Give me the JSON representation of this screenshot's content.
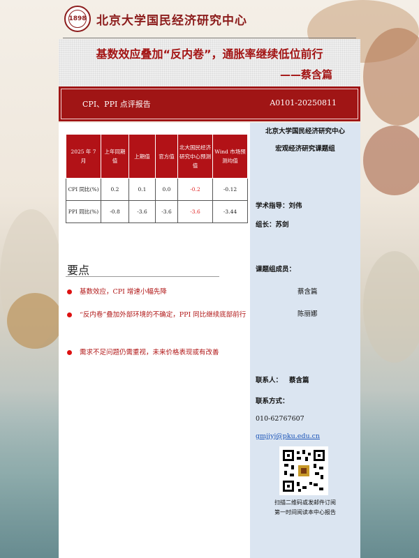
{
  "header": {
    "logo_seal_text": "1898",
    "logo_text": "北京大学国民经济研究中心"
  },
  "title": {
    "main": "基数效应叠加“反内卷”，通胀率继续低位前行",
    "author": "——蔡含篇"
  },
  "banner": {
    "report_type": "CPI、PPI 点评报告",
    "report_code": "A0101-20250811"
  },
  "table": {
    "headers": [
      "2025 年 7 月",
      "上年同期值",
      "上期值",
      "官方值",
      "北大国民经济研究中心预测值",
      "Wind 市场预测均值"
    ],
    "rows": [
      {
        "label": "CPI 同比(%)",
        "values": [
          "0.2",
          "0.1",
          "0.0",
          "-0.2",
          "-0.12"
        ]
      },
      {
        "label": "PPI 同比(%)",
        "values": [
          "-0.8",
          "-3.6",
          "-3.6",
          "-3.6",
          "-3.44"
        ]
      }
    ],
    "highlight_color": "#e02020"
  },
  "key_points": {
    "title": "要点",
    "items": [
      "基数效应，CPI 增速小幅先降",
      "“反内卷”叠加外部环境的不确定，PPI 同比继续底部前行",
      "需求不足问题仍需重视，未来价格表现或有改善"
    ]
  },
  "sidebar": {
    "org": "北京大学国民经济研究中心",
    "group": "宏观经济研究课题组",
    "advisor": "学术指导：刘伟",
    "leader": "组长：苏剑",
    "members_label": "课题组成员：",
    "members": [
      "蔡含篇",
      "陈丽娜"
    ],
    "contact_label": "联系人：",
    "contact_name": "蔡含篇",
    "contact_method_label": "联系方式：",
    "phone": "010-62767607",
    "email": "gmjjyj@pku.edu.cn",
    "qr_caption_1": "扫描二维码或发邮件订阅",
    "qr_caption_2": "第一时间阅读本中心报告"
  },
  "colors": {
    "brand_red": "#a01515",
    "sidebar_bg": "#dbe5f1"
  }
}
